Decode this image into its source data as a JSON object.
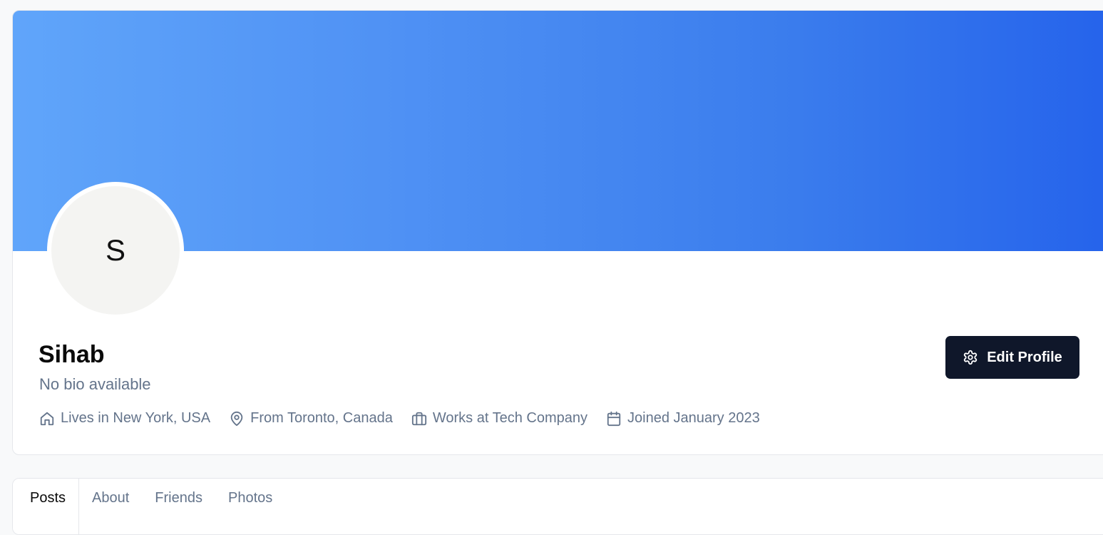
{
  "profile": {
    "avatar_initial": "S",
    "name": "Sihab",
    "bio": "No bio available",
    "edit_button_label": "Edit Profile",
    "details": {
      "lives": "Lives in New York, USA",
      "from": "From Toronto, Canada",
      "works": "Works at Tech Company",
      "joined": "Joined January 2023"
    }
  },
  "tabs": [
    {
      "label": "Posts"
    },
    {
      "label": "About"
    },
    {
      "label": "Friends"
    },
    {
      "label": "Photos"
    }
  ],
  "colors": {
    "cover_start": "#60a5fa",
    "cover_end": "#2563eb",
    "button_bg": "#0f172a",
    "muted_text": "#64748b"
  }
}
